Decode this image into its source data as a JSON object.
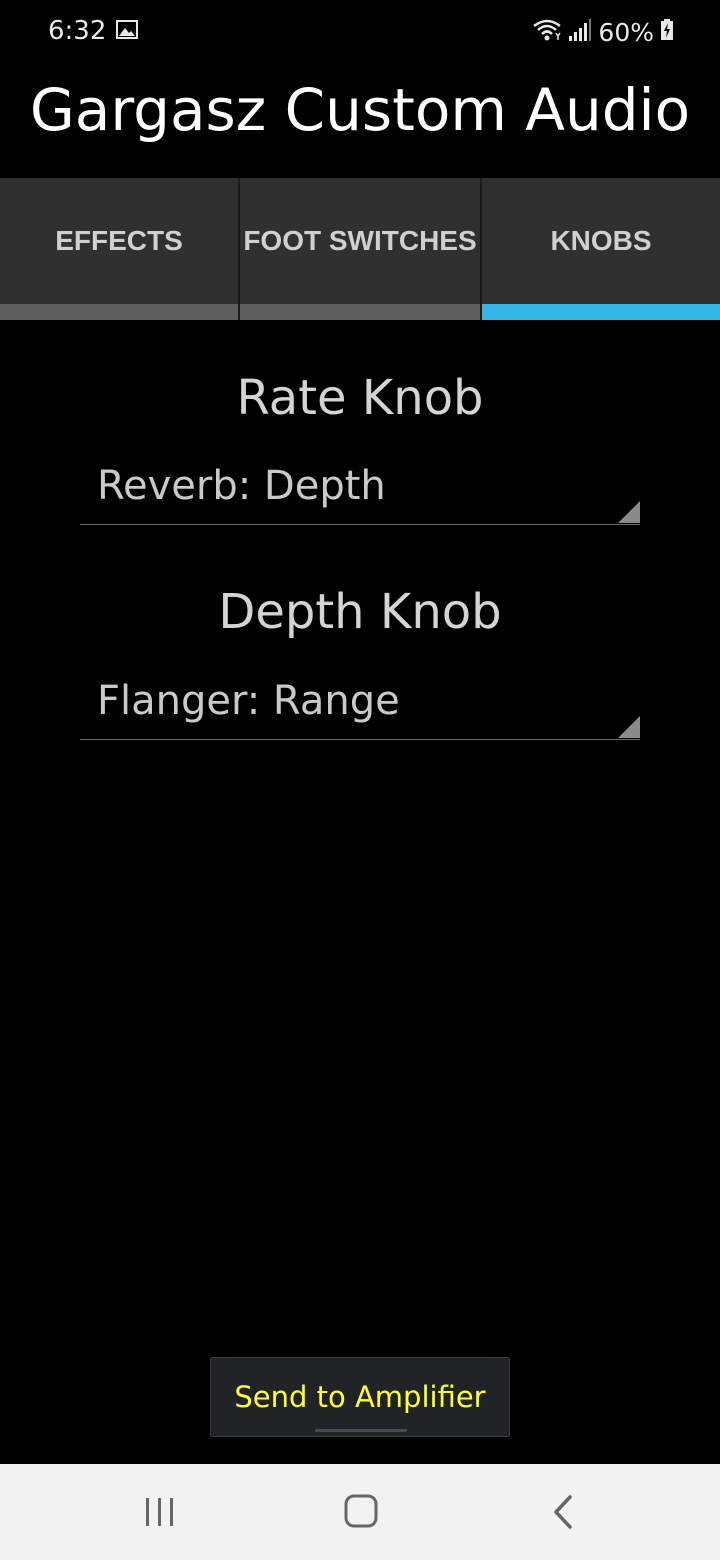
{
  "status_bar": {
    "time": "6:32",
    "battery": "60%",
    "icons": [
      "image-icon",
      "wifi-icon",
      "signal-icon",
      "battery-charging-icon"
    ]
  },
  "app": {
    "title": "Gargasz Custom Audio"
  },
  "tabs": [
    {
      "label": "EFFECTS",
      "active": false
    },
    {
      "label": "FOOT SWITCHES",
      "active": false
    },
    {
      "label": "KNOBS",
      "active": true
    }
  ],
  "knobs": [
    {
      "title": "Rate Knob",
      "selected": "Reverb: Depth"
    },
    {
      "title": "Depth Knob",
      "selected": "Flanger: Range"
    }
  ],
  "send_button": {
    "label": "Send to Amplifier"
  },
  "nav_bar": {
    "icons": [
      "recent-apps-icon",
      "home-icon",
      "back-icon"
    ]
  },
  "colors": {
    "accent": "#33b5e5",
    "button_text": "#ffff33",
    "background": "#000000"
  }
}
